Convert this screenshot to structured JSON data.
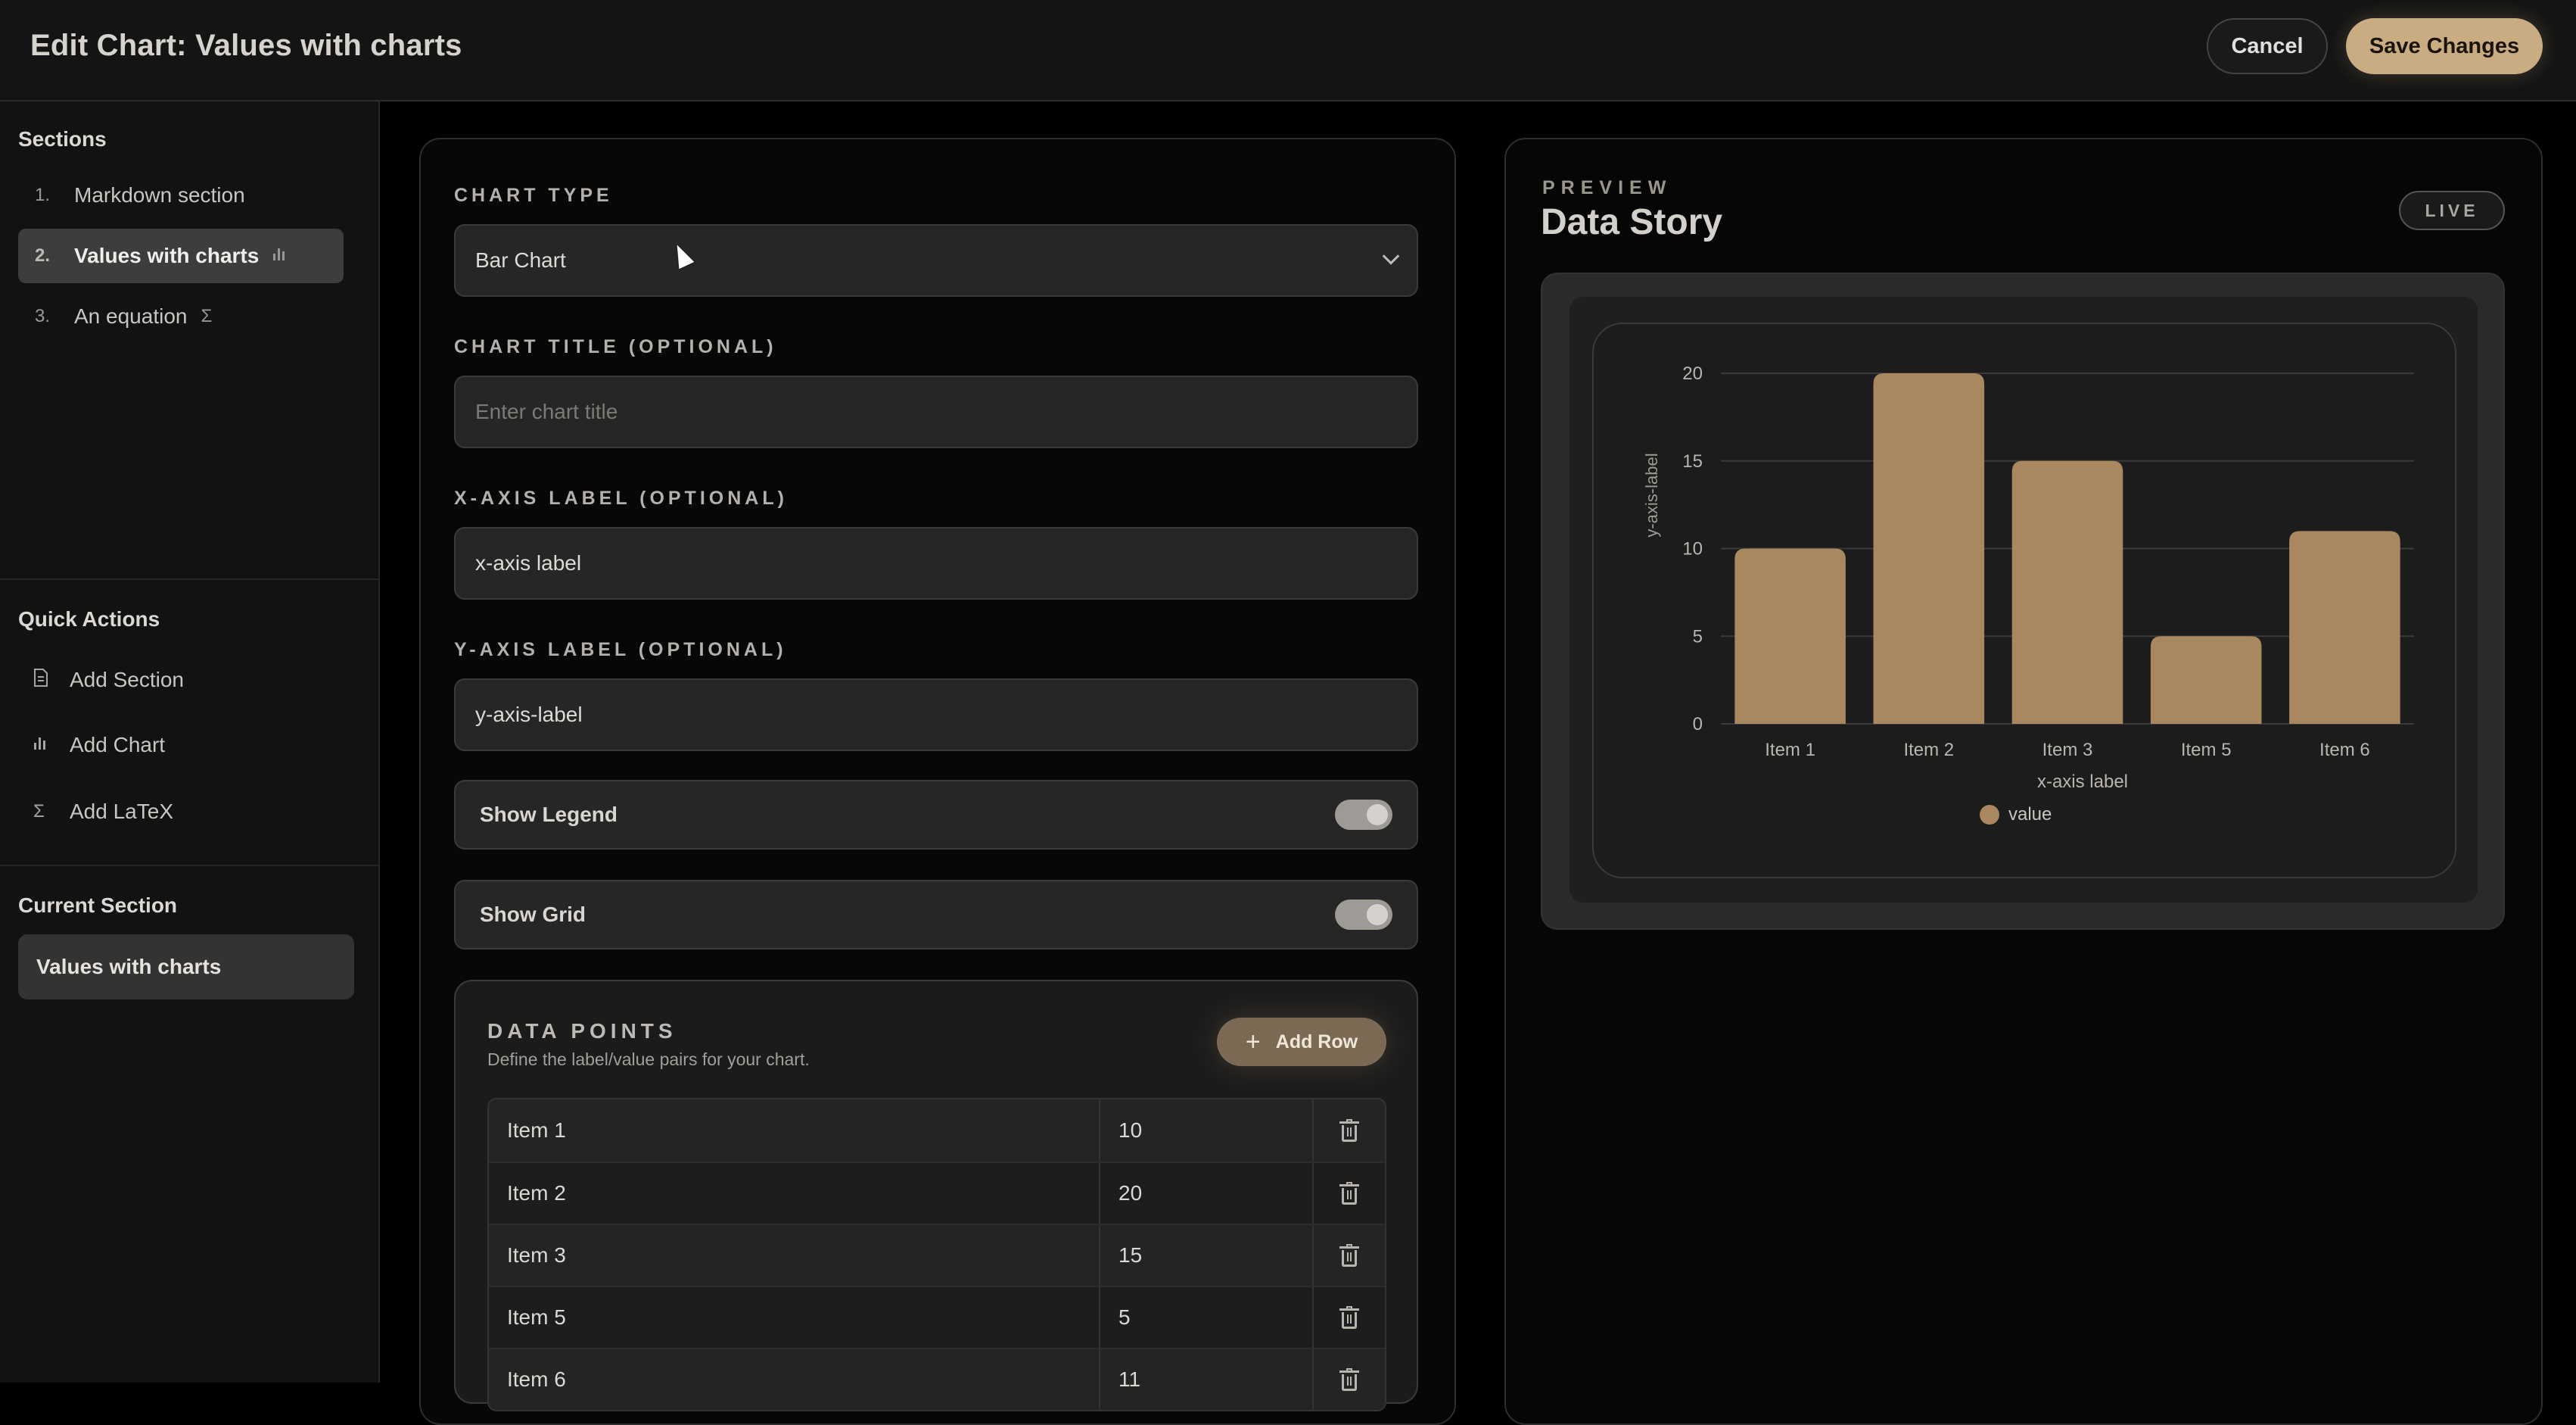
{
  "header": {
    "title": "Edit Chart: Values with charts",
    "cancel_label": "Cancel",
    "save_label": "Save Changes"
  },
  "sidebar": {
    "sections_heading": "Sections",
    "sections": [
      {
        "num": "1.",
        "label": "Markdown section",
        "icon": ""
      },
      {
        "num": "2.",
        "label": "Values with charts",
        "icon": "bar-chart-icon"
      },
      {
        "num": "3.",
        "label": "An equation",
        "icon": "sigma-icon"
      }
    ],
    "quick_actions_heading": "Quick Actions",
    "quick_actions": [
      {
        "label": "Add Section",
        "icon": "document-icon"
      },
      {
        "label": "Add Chart",
        "icon": "bar-chart-icon"
      },
      {
        "label": "Add LaTeX",
        "icon": "sigma-icon"
      }
    ],
    "current_heading": "Current Section",
    "current_value": "Values with charts"
  },
  "editor": {
    "chart_type_label": "CHART TYPE",
    "chart_type_value": "Bar Chart",
    "chart_title_label": "CHART TITLE (OPTIONAL)",
    "chart_title_placeholder": "Enter chart title",
    "x_label_label": "X-AXIS LABEL (OPTIONAL)",
    "x_label_value": "x-axis label",
    "y_label_label": "Y-AXIS LABEL (OPTIONAL)",
    "y_label_value": "y-axis-label",
    "show_legend_label": "Show Legend",
    "show_legend": true,
    "show_grid_label": "Show Grid",
    "show_grid": true,
    "data_points_title": "DATA POINTS",
    "data_points_subtitle": "Define the label/value pairs for your chart.",
    "add_row_label": "Add Row",
    "rows": [
      {
        "label": "Item 1",
        "value": "10"
      },
      {
        "label": "Item 2",
        "value": "20"
      },
      {
        "label": "Item 3",
        "value": "15"
      },
      {
        "label": "Item 5",
        "value": "5"
      },
      {
        "label": "Item 6",
        "value": "11"
      }
    ]
  },
  "preview": {
    "kicker": "PREVIEW",
    "title": "Data Story",
    "badge": "LIVE"
  },
  "chart_data": {
    "type": "bar",
    "categories": [
      "Item 1",
      "Item 2",
      "Item 3",
      "Item 5",
      "Item 6"
    ],
    "series": [
      {
        "name": "value",
        "values": [
          10,
          20,
          15,
          5,
          11
        ]
      }
    ],
    "title": "",
    "xlabel": "x-axis label",
    "ylabel": "y-axis-label",
    "ylim": [
      0,
      20
    ],
    "yticks": [
      0,
      5,
      10,
      15,
      20
    ],
    "grid": true,
    "legend": "bottom",
    "bar_color": "#a9885f"
  },
  "colors": {
    "accent": "#c9ac82",
    "bar": "#a9885f"
  }
}
